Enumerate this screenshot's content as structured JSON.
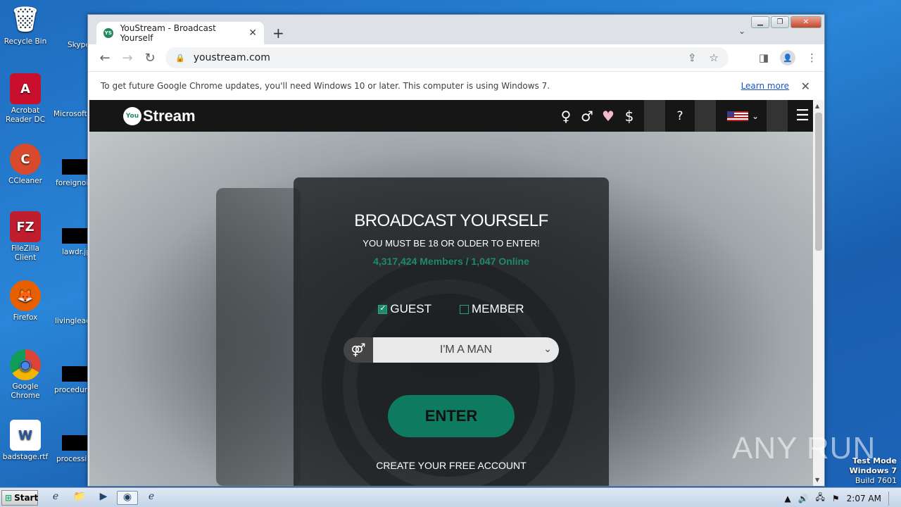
{
  "desktop": {
    "icons": [
      {
        "label": "Recycle Bin",
        "glyph": "🗑"
      },
      {
        "label": "Acrobat Reader DC",
        "glyph": "A"
      },
      {
        "label": "CCleaner",
        "glyph": "C"
      },
      {
        "label": "FileZilla Client",
        "glyph": "FZ"
      },
      {
        "label": "Firefox",
        "glyph": "🦊"
      },
      {
        "label": "Google Chrome",
        "glyph": "◉"
      },
      {
        "label": "badstage.rtf",
        "glyph": "W"
      }
    ],
    "second_column": [
      "Skype",
      "Microsoft",
      "foreignoil",
      "lawdr.jp",
      "livinglead",
      "procedure",
      "processin"
    ],
    "watermark": "ANY RUN",
    "test_mode": [
      "Test Mode",
      "Windows 7",
      "Build 7601"
    ]
  },
  "browser": {
    "tab_title": "YouStream - Broadcast Yourself",
    "tab_favicon": "YS",
    "url": "youstream.com",
    "infobar_text": "To get future Google Chrome updates, you'll need Windows 10 or later. This computer is using Windows 7.",
    "infobar_link": "Learn more"
  },
  "site": {
    "logo_you": "You",
    "logo_stream": "Stream",
    "header_icons": [
      "♀",
      "♂",
      "♥",
      "$",
      "?"
    ],
    "panel": {
      "title": "BROADCAST YOURSELF",
      "subtitle": "YOU MUST BE 18 OR OLDER TO ENTER!",
      "stats": "4,317,424 Members / 1,047 Online",
      "option_guest": "GUEST",
      "option_member": "MEMBER",
      "gender_value": "I'M A MAN",
      "enter_label": "ENTER",
      "create_link": "CREATE YOUR FREE ACCOUNT"
    }
  },
  "taskbar": {
    "start_label": "Start",
    "clock": "2:07 AM"
  }
}
